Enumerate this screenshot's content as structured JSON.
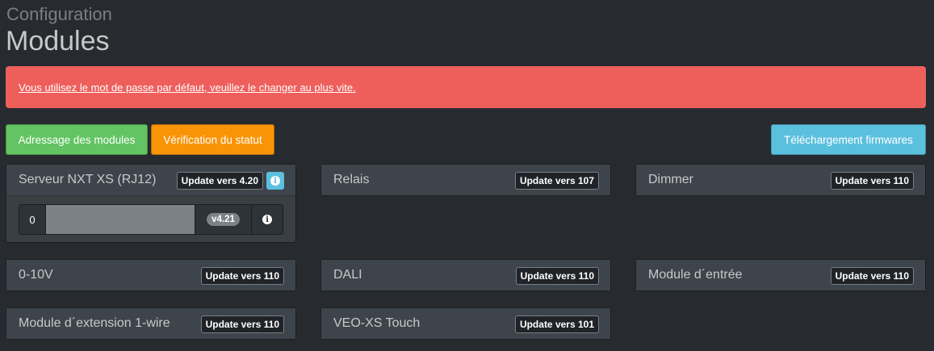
{
  "header": {
    "breadcrumb": "Configuration",
    "title": "Modules"
  },
  "alert": {
    "text": "Vous utilisez le mot de passe par défaut, veuillez le changer au plus vite."
  },
  "actions": {
    "addressing": "Adressage des modules",
    "status_check": "Vérification du statut",
    "firmware_download": "Téléchargement firmwares"
  },
  "modules": [
    {
      "name": "Serveur NXT XS (RJ12)",
      "update": "Update vers 4.20",
      "has_info": true,
      "device": {
        "index": "0",
        "version": "v4.21"
      }
    },
    {
      "name": "Relais",
      "update": "Update vers 107"
    },
    {
      "name": "Dimmer",
      "update": "Update vers 110"
    },
    {
      "name": "0-10V",
      "update": "Update vers 110"
    },
    {
      "name": "DALI",
      "update": "Update vers 110"
    },
    {
      "name": "Module d´entrée",
      "update": "Update vers 110"
    },
    {
      "name": "Module d´extension 1-wire",
      "update": "Update vers 110"
    },
    {
      "name": "VEO-XS Touch",
      "update": "Update vers 101"
    }
  ],
  "colors": {
    "background": "#272b30",
    "alert": "#ee5f5b",
    "success": "#62c462",
    "warning": "#f89406",
    "info": "#5bc0de"
  },
  "icons": {
    "info": "info-icon"
  }
}
